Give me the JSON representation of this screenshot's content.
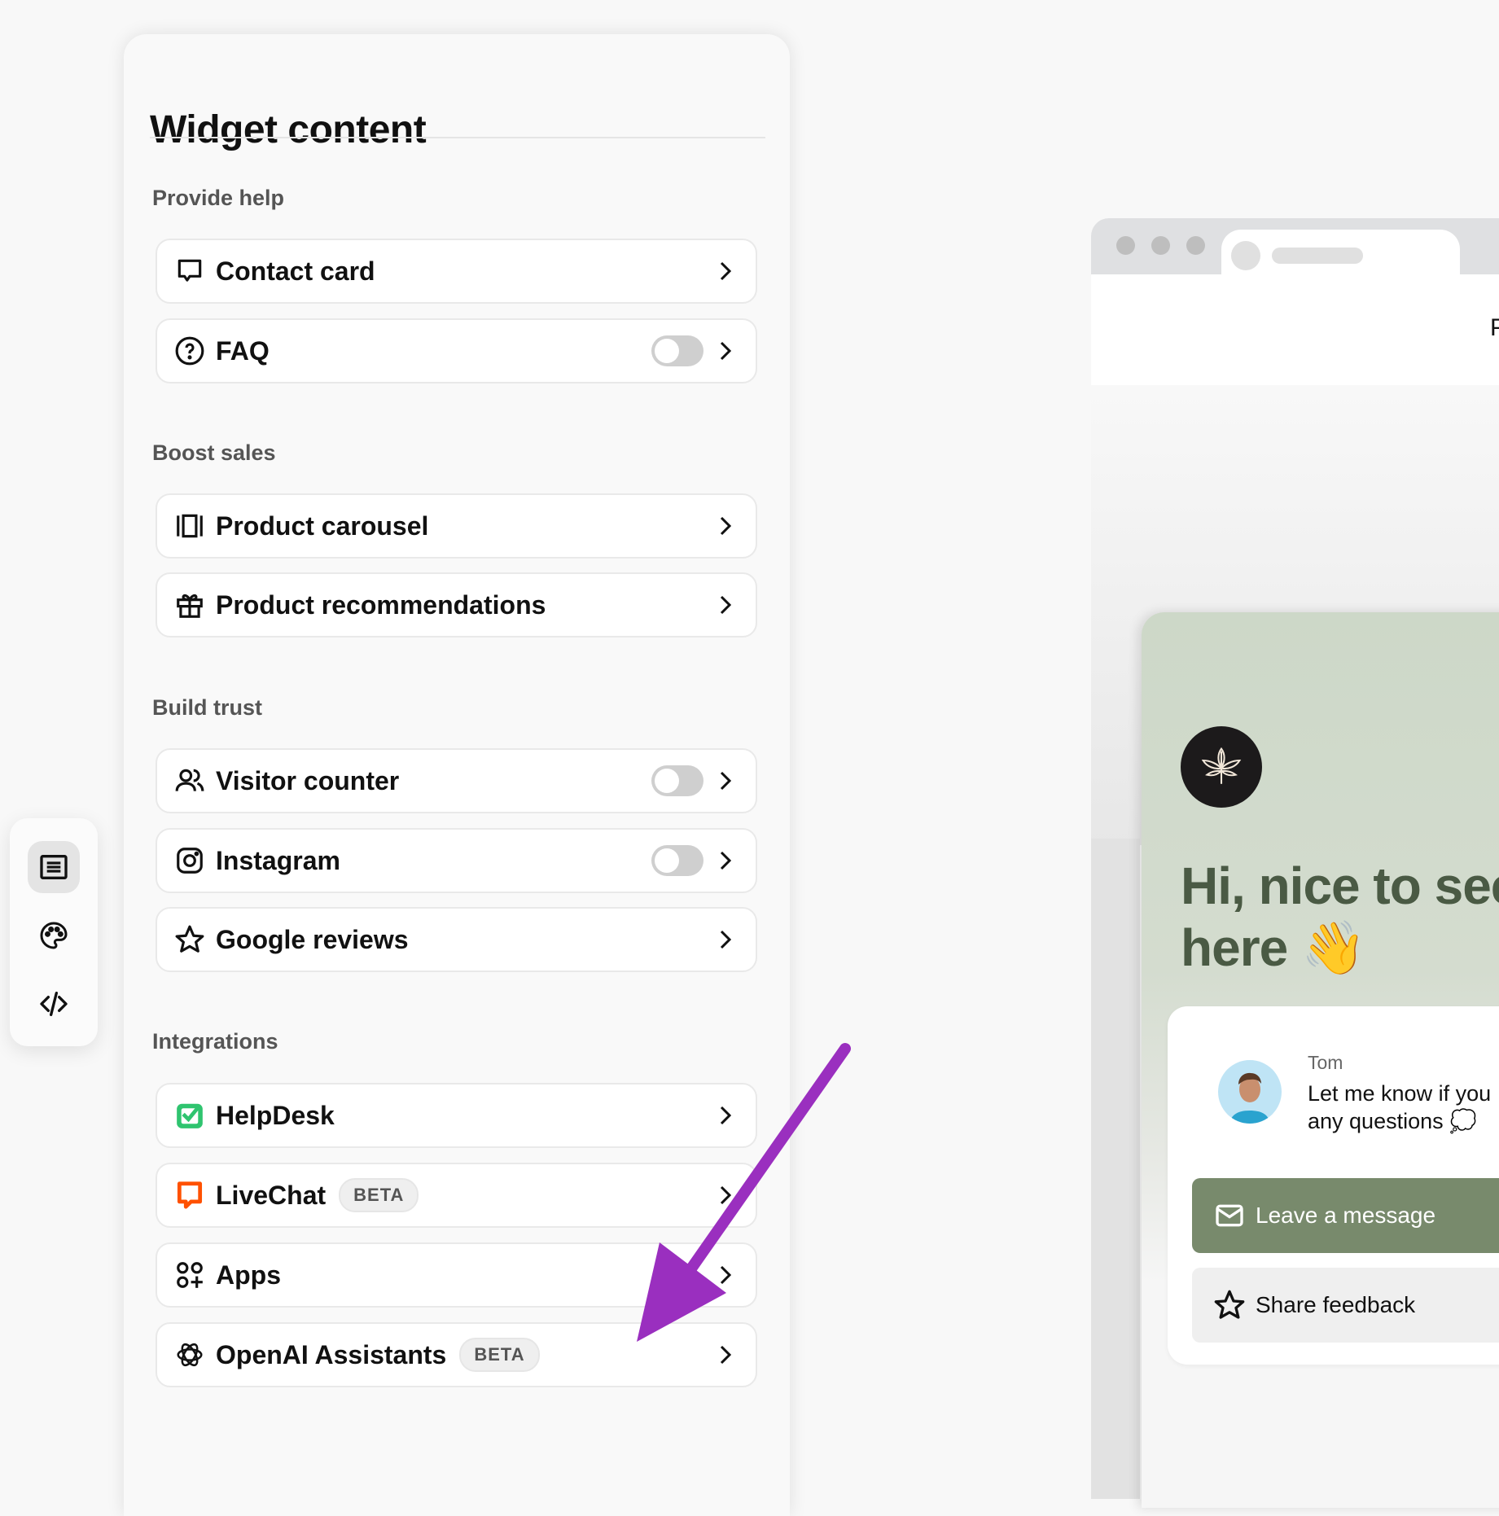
{
  "panel": {
    "title": "Widget content",
    "sections": [
      {
        "label": "Provide help",
        "items": [
          {
            "label": "Contact card",
            "icon": "chat-bubble-icon",
            "toggle": false
          },
          {
            "label": "FAQ",
            "icon": "question-circle-icon",
            "toggle": true,
            "toggle_on": false
          }
        ]
      },
      {
        "label": "Boost sales",
        "items": [
          {
            "label": "Product carousel",
            "icon": "carousel-icon",
            "toggle": false
          },
          {
            "label": "Product recommendations",
            "icon": "gift-icon",
            "toggle": false
          }
        ]
      },
      {
        "label": "Build trust",
        "items": [
          {
            "label": "Visitor counter",
            "icon": "users-icon",
            "toggle": true,
            "toggle_on": false
          },
          {
            "label": "Instagram",
            "icon": "instagram-icon",
            "toggle": true,
            "toggle_on": false
          },
          {
            "label": "Google reviews",
            "icon": "star-icon",
            "toggle": false
          }
        ]
      },
      {
        "label": "Integrations",
        "items": [
          {
            "label": "HelpDesk",
            "icon": "helpdesk-icon",
            "toggle": false
          },
          {
            "label": "LiveChat",
            "icon": "livechat-icon",
            "badge": "BETA",
            "toggle": false
          },
          {
            "label": "Apps",
            "icon": "apps-icon",
            "toggle": false
          },
          {
            "label": "OpenAI Assistants",
            "icon": "openai-icon",
            "badge": "BETA",
            "toggle": false
          }
        ]
      }
    ]
  },
  "rail": {
    "items": [
      {
        "icon": "content-list-icon",
        "active": true
      },
      {
        "icon": "palette-icon",
        "active": false
      },
      {
        "icon": "code-icon",
        "active": false
      }
    ]
  },
  "preview": {
    "browser_text": "P",
    "greeting_line1": "Hi, nice to see",
    "greeting_line2": "here 👋",
    "agent_name": "Tom",
    "agent_msg_line1": "Let me know if you",
    "agent_msg_line2": "any questions 💭",
    "leave_message": "Leave a message",
    "share_feedback": "Share feedback"
  },
  "colors": {
    "accent_green": "#788a6c",
    "annotation_arrow": "#9a2fbf",
    "helpdesk_green": "#2fc46f",
    "livechat_orange": "#ff5100"
  }
}
